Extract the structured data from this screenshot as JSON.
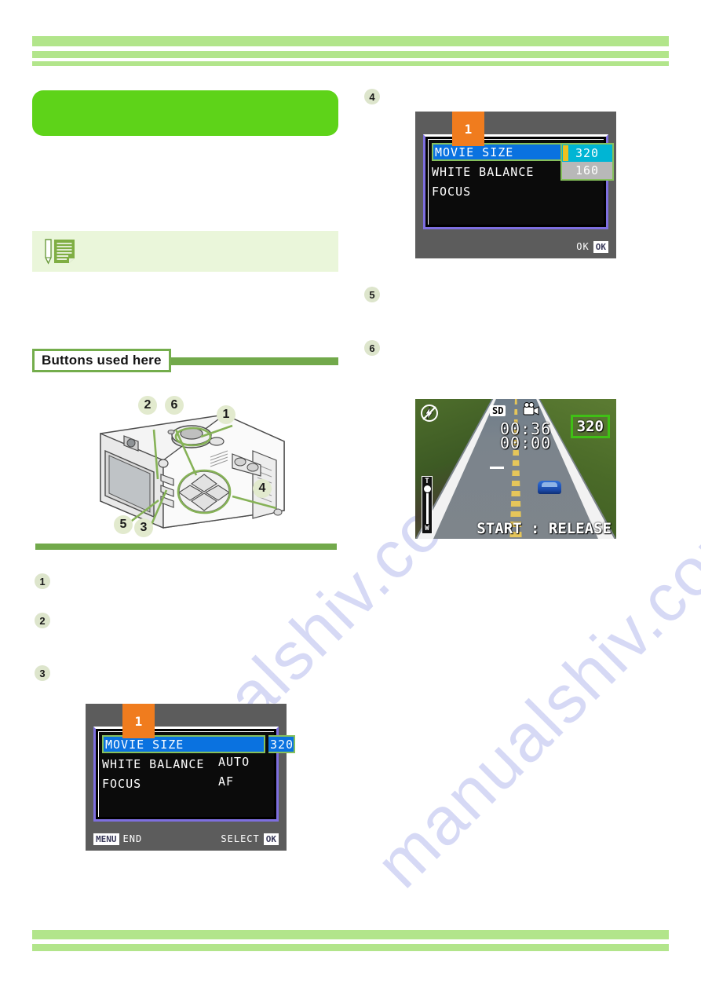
{
  "document": {
    "title_pill_text": "",
    "watermark": "manualshiv.com",
    "buttons_used_here_label": "Buttons used here"
  },
  "note_box": {
    "icon": "memo-pencil-icon",
    "text": ""
  },
  "camera_figure": {
    "callouts": [
      "2",
      "6",
      "1",
      "4",
      "5",
      "3"
    ]
  },
  "steps": {
    "left_column": [
      "1",
      "2",
      "3"
    ],
    "right_column": [
      "4",
      "5",
      "6"
    ]
  },
  "lcd_menu_step4": {
    "tab_number": "1",
    "rows": [
      {
        "label": "MOVIE SIZE",
        "value": "320",
        "highlighted": true
      },
      {
        "label": "WHITE BALANCE",
        "value": "",
        "highlighted": false
      },
      {
        "label": "FOCUS",
        "value": "",
        "highlighted": false
      }
    ],
    "dropdown": {
      "selected": "320",
      "options": [
        "320",
        "160"
      ]
    },
    "footer": {
      "left_key": "",
      "left_label": "",
      "right_label": "OK",
      "right_key": "OK"
    }
  },
  "lcd_menu_step3": {
    "tab_number": "1",
    "rows": [
      {
        "label": "MOVIE SIZE",
        "value": "320",
        "highlighted": true
      },
      {
        "label": "WHITE BALANCE",
        "value": "AUTO",
        "highlighted": false
      },
      {
        "label": "FOCUS",
        "value": "AF",
        "highlighted": false
      }
    ],
    "footer": {
      "left_key": "MENU",
      "left_label": "END",
      "right_label": "SELECT",
      "right_key": "OK"
    }
  },
  "lcd_live_view": {
    "flash_icon": "flash-off-icon",
    "card_icon": "SD",
    "mode_icon": "movie-camera-icon",
    "time_remaining": "00:36",
    "time_elapsed": "00:00",
    "movie_size_badge": "320",
    "start_hint": "START : RELEASE",
    "zoom_top": "T",
    "zoom_bottom": "W"
  },
  "colors": {
    "header_bar": "#b2e58b",
    "title_pill": "#5ed319",
    "note_bg": "#eaf6da",
    "accent_green": "#72a94b",
    "highlight_blue": "#0a72e0",
    "select_green": "#86c05c",
    "tab_orange": "#f07c1e",
    "badge_green": "#3fc015",
    "watermark": "#c9cdf2"
  }
}
